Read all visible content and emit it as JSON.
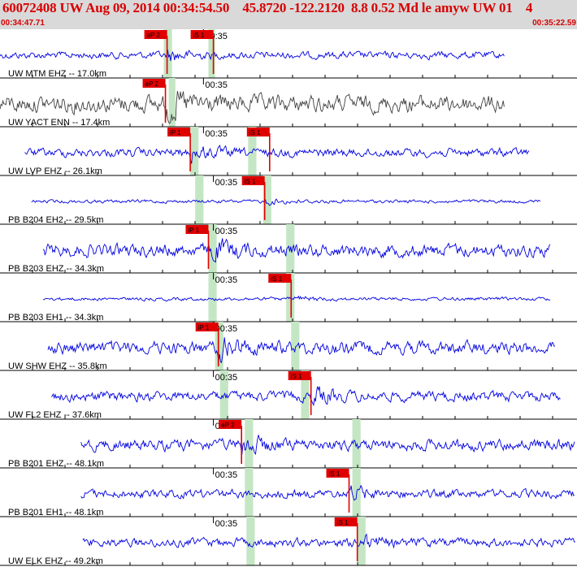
{
  "header": {
    "title": "60072408 UW Aug 09, 2014 00:34:54.50    45.8720 -122.2120  8.8 0.52 Md le amyw UW 01    4",
    "start_time": "00:34:47.71",
    "end_time": "00:35:22.59"
  },
  "colors": {
    "header_bg": "#d9d9d9",
    "title": "#d80000",
    "trace": "#0000e0",
    "trace_alt": "#404040",
    "pick_bg": "#e00000",
    "pick_text": "#000000",
    "window": "#c4e6c4",
    "minute_label": "#000000"
  },
  "chart_data": {
    "type": "seismogram",
    "minute_mark_label": "00:35",
    "time_range_s": [
      0,
      34.88
    ],
    "traces": [
      {
        "label": "UW MTM EHZ -- 17.0km",
        "color": "trace",
        "amplitude": 0.25,
        "data_window_s": [
          0,
          30.5
        ],
        "picks": [
          {
            "label": "eP 2",
            "t": 10.1
          },
          {
            "label": "iS 1",
            "t": 12.9
          }
        ],
        "minute_mark_s": 12.3,
        "windows_s": [
          [
            9.9,
            10.4
          ],
          [
            12.6,
            13.0
          ]
        ]
      },
      {
        "label": "UW YACT ENN -- 17.4km",
        "color": "trace_alt",
        "amplitude": 0.6,
        "data_window_s": [
          0,
          30.5
        ],
        "picks": [
          {
            "label": "eP 2",
            "t": 10.0
          }
        ],
        "minute_mark_s": 12.3,
        "windows_s": [
          [
            10.2,
            10.6
          ]
        ]
      },
      {
        "label": "UW LVP EHZ -- 26.1km",
        "color": "trace",
        "amplitude": 0.3,
        "data_window_s": [
          1.5,
          32.0
        ],
        "picks": [
          {
            "label": "iP 1",
            "t": 11.5
          },
          {
            "label": "iS 1",
            "t": 16.3
          }
        ],
        "minute_mark_s": 12.3,
        "windows_s": [
          [
            11.5,
            12.0
          ],
          [
            15.0,
            15.5
          ]
        ]
      },
      {
        "label": "PB B204 EH2 -- 29.5km",
        "color": "trace",
        "amplitude": 0.12,
        "data_window_s": [
          1.9,
          32.7
        ],
        "picks": [
          {
            "label": "iS 1",
            "t": 16.0
          }
        ],
        "minute_mark_s": 12.9,
        "windows_s": [
          [
            11.8,
            12.3
          ],
          [
            15.9,
            16.4
          ]
        ]
      },
      {
        "label": "PB B203 EHZ -- 34.3km",
        "color": "trace",
        "amplitude": 0.45,
        "data_window_s": [
          2.6,
          33.3
        ],
        "picks": [
          {
            "label": "iP 1",
            "t": 12.6
          }
        ],
        "minute_mark_s": 12.9,
        "windows_s": [
          [
            12.6,
            13.1
          ],
          [
            17.3,
            17.8
          ]
        ]
      },
      {
        "label": "PB B203 EH1 -- 34.3km",
        "color": "trace",
        "amplitude": 0.12,
        "data_window_s": [
          2.6,
          33.3
        ],
        "picks": [
          {
            "label": "iS 1",
            "t": 17.6
          }
        ],
        "minute_mark_s": 12.9,
        "windows_s": [
          [
            12.6,
            13.1
          ],
          [
            17.3,
            17.8
          ]
        ]
      },
      {
        "label": "UW SHW EHZ -- 35.8km",
        "color": "trace",
        "amplitude": 0.45,
        "data_window_s": [
          2.9,
          33.6
        ],
        "picks": [
          {
            "label": "iP 1",
            "t": 13.2
          }
        ],
        "minute_mark_s": 12.9,
        "windows_s": [
          [
            13.0,
            13.5
          ],
          [
            17.6,
            18.1
          ]
        ]
      },
      {
        "label": "UW FL2 EHZ -- 37.6km",
        "color": "trace",
        "amplitude": 0.35,
        "data_window_s": [
          3.1,
          33.9
        ],
        "picks": [
          {
            "label": "iS 1",
            "t": 18.8
          }
        ],
        "minute_mark_s": 12.9,
        "windows_s": [
          [
            13.3,
            13.8
          ],
          [
            18.2,
            18.7
          ]
        ]
      },
      {
        "label": "PB B201 EHZ -- 48.1km",
        "color": "trace",
        "amplitude": 0.4,
        "data_window_s": [
          4.9,
          35.5
        ],
        "picks": [
          {
            "label": "eP 2",
            "t": 14.6
          }
        ],
        "minute_mark_s": 12.9,
        "windows_s": [
          [
            14.8,
            15.3
          ],
          [
            21.3,
            21.8
          ]
        ]
      },
      {
        "label": "PB B201 EH1 -- 48.1km",
        "color": "trace",
        "amplitude": 0.3,
        "data_window_s": [
          4.9,
          35.5
        ],
        "picks": [
          {
            "label": "iS 1",
            "t": 21.1
          }
        ],
        "minute_mark_s": 12.9,
        "windows_s": [
          [
            14.8,
            15.3
          ],
          [
            21.3,
            21.8
          ]
        ]
      },
      {
        "label": "UW ELK EHZ -- 49.2km",
        "color": "trace",
        "amplitude": 0.3,
        "data_window_s": [
          5.0,
          35.5
        ],
        "picks": [
          {
            "label": "iS 1",
            "t": 21.6
          }
        ],
        "minute_mark_s": 12.9,
        "windows_s": [
          [
            14.9,
            15.4
          ],
          [
            21.6,
            22.1
          ]
        ]
      }
    ]
  }
}
